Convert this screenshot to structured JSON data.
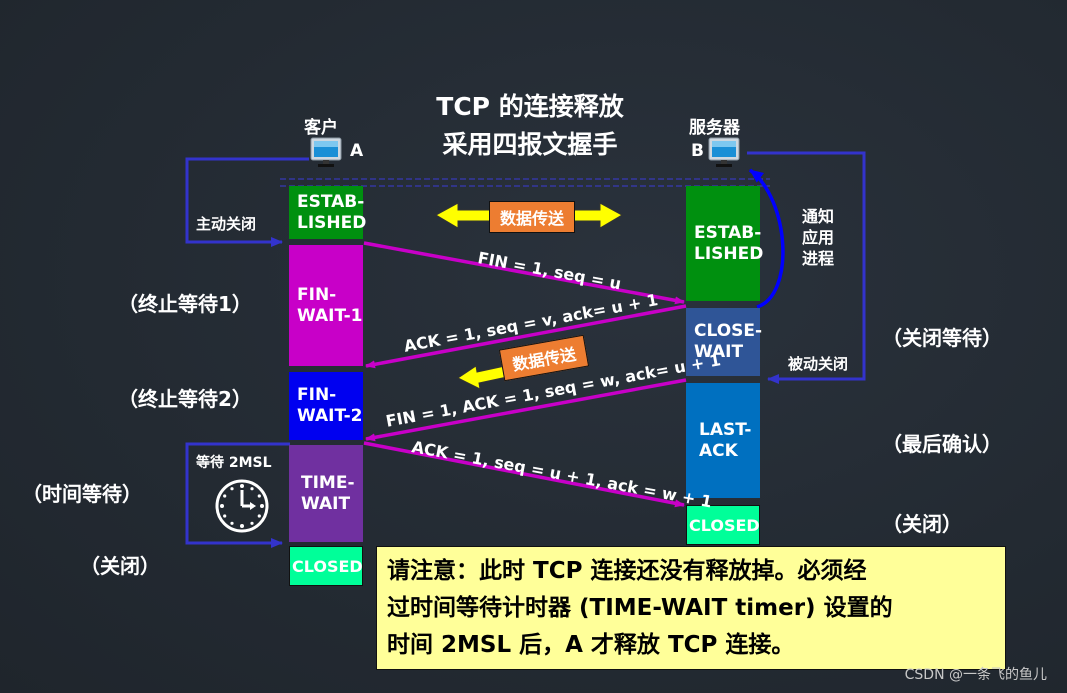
{
  "title": {
    "line1": "TCP 的连接释放",
    "line2": "采用四报文握手"
  },
  "client": {
    "name": "客户",
    "label": "A",
    "icon": "computer-monitor-icon"
  },
  "server": {
    "name": "服务器",
    "label": "B",
    "icon": "computer-monitor-icon"
  },
  "client_states": [
    {
      "id": "established",
      "text": "ESTAB-\nLISHED",
      "color": "#00900f",
      "cn_label": ""
    },
    {
      "id": "fin-wait-1",
      "text": "FIN-\nWAIT-1",
      "color": "#c800c8",
      "cn_label": "（终止等待1）"
    },
    {
      "id": "fin-wait-2",
      "text": "FIN-\nWAIT-2",
      "color": "#0000f0",
      "cn_label": "（终止等待2）"
    },
    {
      "id": "time-wait",
      "text": "TIME-\nWAIT",
      "color": "#7030a0",
      "cn_label": "（时间等待）"
    },
    {
      "id": "closed",
      "text": "CLOSED",
      "color": "#00ff99",
      "cn_label": "（关闭）"
    }
  ],
  "server_states": [
    {
      "id": "established",
      "text": "ESTAB-\nLISHED",
      "color": "#00900f",
      "cn_label": ""
    },
    {
      "id": "close-wait",
      "text": "CLOSE-\nWAIT",
      "color": "#2f5597",
      "cn_label": "（关闭等待）"
    },
    {
      "id": "last-ack",
      "text": "LAST-\nACK",
      "color": "#0070c0",
      "cn_label": "（最后确认）"
    },
    {
      "id": "closed",
      "text": "CLOSED",
      "color": "#00ff99",
      "cn_label": "（关闭）"
    }
  ],
  "annotations": {
    "active_close": "主动关闭",
    "passive_close": "被动关闭",
    "notify_app": "通知\n应用\n进程",
    "wait_2msl": "等待 2MSL",
    "clock_icon": "clock-icon"
  },
  "data_transfer": {
    "label": "数据传送",
    "box_color": "#ed7d31",
    "arrow_color": "#ffff00"
  },
  "messages": [
    {
      "id": "fin1",
      "text": "FIN = 1, seq = u",
      "direction": "A→B"
    },
    {
      "id": "ack1",
      "text": "ACK = 1, seq = v, ack= u + 1",
      "direction": "B→A"
    },
    {
      "id": "fin2",
      "text": "FIN = 1, ACK = 1, seq = w, ack= u + 1",
      "direction": "B→A"
    },
    {
      "id": "ack2",
      "text": "ACK = 1, seq = u + 1, ack = w + 1",
      "direction": "A→B"
    }
  ],
  "colors": {
    "message_arrow": "#c800c8",
    "flow_line": "#3333cc",
    "notify_arrow": "#0000ff",
    "note_background": "#ffff99"
  },
  "note": {
    "lines": [
      "请注意：此时 TCP 连接还没有释放掉。必须经",
      "过时间等待计时器 (TIME-WAIT timer) 设置的",
      "时间 2MSL 后，A 才释放 TCP 连接。"
    ]
  },
  "watermark": "CSDN @一条飞的鱼儿"
}
